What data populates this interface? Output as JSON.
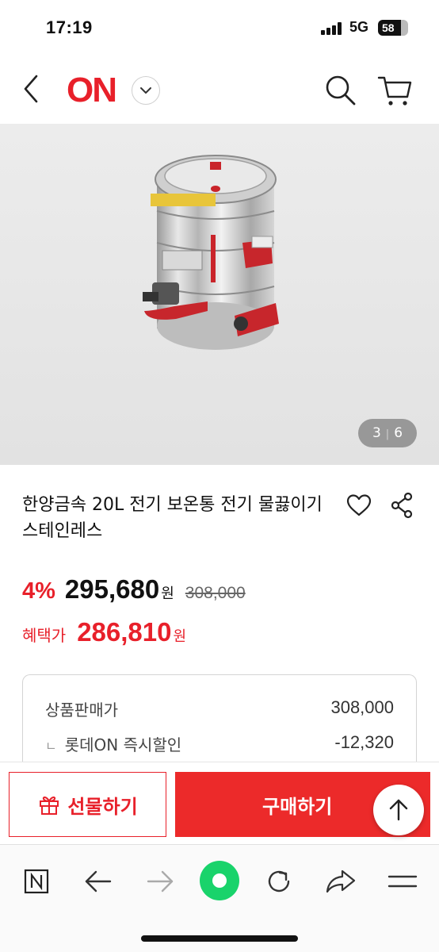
{
  "status_bar": {
    "time": "17:19",
    "network": "5G",
    "battery": "58"
  },
  "header": {
    "logo_text": "ON",
    "brand_color": "#e8202a",
    "icons": [
      "back-icon",
      "chevron-down-icon",
      "search-icon",
      "cart-icon"
    ]
  },
  "gallery": {
    "current": "3",
    "separator": "|",
    "total": "6"
  },
  "product": {
    "title": "한양금속 20L 전기 보온통 전기 물끓이기 스테인레스"
  },
  "price": {
    "discount": "4%",
    "sale_price": "295,680",
    "currency": "원",
    "original_price": "308,000",
    "benefit_label": "혜택가",
    "benefit_price": "286,810"
  },
  "breakdown": {
    "rows": [
      {
        "label": "상품판매가",
        "value": "308,000"
      },
      {
        "label": "롯데ON 즉시할인",
        "value": "-12,320",
        "bullet": "ㄴ"
      }
    ]
  },
  "actions": {
    "gift_label": "선물하기",
    "buy_label": "구매하기"
  },
  "browser_toolbar": {
    "icons": [
      "naver-n-icon",
      "back-arrow-icon",
      "forward-arrow-icon",
      "green-home-icon",
      "reload-icon",
      "share-arrow-icon",
      "menu-icon"
    ]
  }
}
